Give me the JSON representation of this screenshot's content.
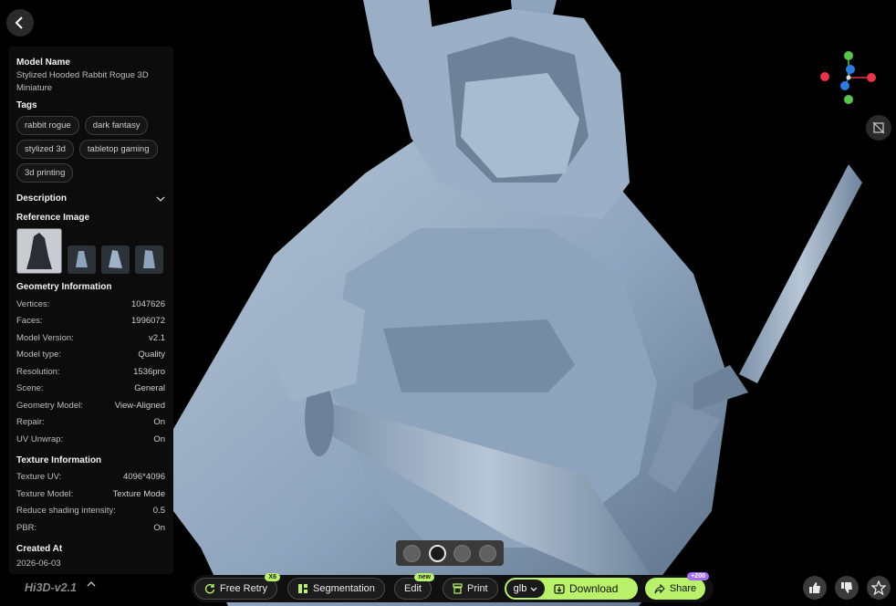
{
  "model_info": {
    "name_label": "Model Name",
    "name": "Stylized Hooded Rabbit Rogue 3D Miniature",
    "tags_label": "Tags",
    "tags": [
      "rabbit rogue",
      "dark fantasy",
      "stylized 3d",
      "tabletop gaming",
      "3d printing"
    ],
    "description_label": "Description",
    "reference_label": "Reference Image",
    "geometry_label": "Geometry Information",
    "geometry": [
      {
        "k": "Vertices:",
        "v": "1047626"
      },
      {
        "k": "Faces:",
        "v": "1996072"
      },
      {
        "k": "Model Version:",
        "v": "v2.1"
      },
      {
        "k": "Model type:",
        "v": "Quality"
      },
      {
        "k": "Resolution:",
        "v": "1536pro"
      },
      {
        "k": "Scene:",
        "v": "General"
      },
      {
        "k": "Geometry Model:",
        "v": "View-Aligned"
      },
      {
        "k": "Repair:",
        "v": "On"
      },
      {
        "k": "UV Unwrap:",
        "v": "On"
      }
    ],
    "texture_label": "Texture Information",
    "texture": [
      {
        "k": "Texture UV:",
        "v": "4096*4096"
      },
      {
        "k": "Texture Model:",
        "v": "Texture Mode"
      },
      {
        "k": "Reduce shading intensity:",
        "v": "0.5"
      },
      {
        "k": "PBR:",
        "v": "On"
      }
    ],
    "created_label": "Created At",
    "created": "2026-06-03"
  },
  "brand": "Hi3D-v2.1",
  "toolbar": {
    "free_retry": "Free Retry",
    "free_retry_badge": "X6",
    "segmentation": "Segmentation",
    "edit": "Edit",
    "edit_badge": "new",
    "print": "Print",
    "format": "glb",
    "download": "Download",
    "share": "Share",
    "share_badge": "+200"
  },
  "icons": [
    "back-icon",
    "hide-texture-icon",
    "chevron-down-icon",
    "chevron-up-icon",
    "retry-icon",
    "segmentation-icon",
    "print-icon",
    "download-icon",
    "share-icon",
    "thumbs-up-icon",
    "thumbs-down-icon",
    "star-icon"
  ],
  "colors": {
    "accent": "#b9f26a",
    "badge_purple": "#a56ef0",
    "axis_x": "#e8344a",
    "axis_y": "#58c44f",
    "axis_z": "#2d7be0",
    "model": "#8ea4bd"
  }
}
